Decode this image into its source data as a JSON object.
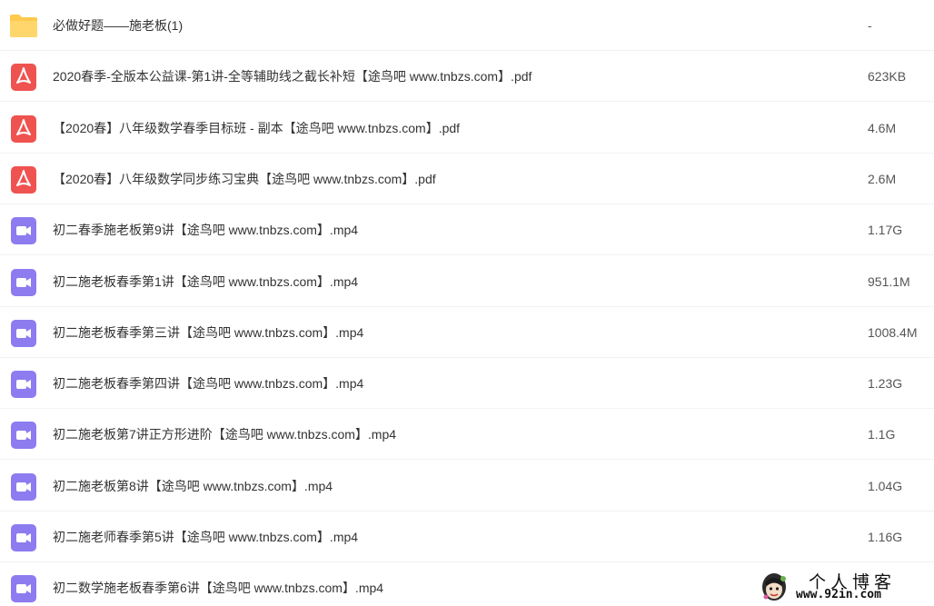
{
  "colors": {
    "folder": "#FFC94D",
    "pdf": "#EF5350",
    "video": "#8C7CF0"
  },
  "files": [
    {
      "icon": "folder-icon",
      "name": "必做好题——施老板(1)",
      "size": "-"
    },
    {
      "icon": "pdf-icon",
      "name": "2020春季-全版本公益课-第1讲-全等辅助线之截长补短【途鸟吧 www.tnbzs.com】.pdf",
      "size": "623KB"
    },
    {
      "icon": "pdf-icon",
      "name": "【2020春】八年级数学春季目标班 - 副本【途鸟吧 www.tnbzs.com】.pdf",
      "size": "4.6M"
    },
    {
      "icon": "pdf-icon",
      "name": "【2020春】八年级数学同步练习宝典【途鸟吧 www.tnbzs.com】.pdf",
      "size": "2.6M"
    },
    {
      "icon": "video-icon",
      "name": "初二春季施老板第9讲【途鸟吧 www.tnbzs.com】.mp4",
      "size": "1.17G"
    },
    {
      "icon": "video-icon",
      "name": "初二施老板春季第1讲【途鸟吧 www.tnbzs.com】.mp4",
      "size": "951.1M"
    },
    {
      "icon": "video-icon",
      "name": "初二施老板春季第三讲【途鸟吧 www.tnbzs.com】.mp4",
      "size": "1008.4M"
    },
    {
      "icon": "video-icon",
      "name": "初二施老板春季第四讲【途鸟吧 www.tnbzs.com】.mp4",
      "size": "1.23G"
    },
    {
      "icon": "video-icon",
      "name": "初二施老板第7讲正方形进阶【途鸟吧 www.tnbzs.com】.mp4",
      "size": "1.1G"
    },
    {
      "icon": "video-icon",
      "name": "初二施老板第8讲【途鸟吧 www.tnbzs.com】.mp4",
      "size": "1.04G"
    },
    {
      "icon": "video-icon",
      "name": "初二施老师春季第5讲【途鸟吧 www.tnbzs.com】.mp4",
      "size": "1.16G"
    },
    {
      "icon": "video-icon",
      "name": "初二数学施老板春季第6讲【途鸟吧 www.tnbzs.com】.mp4",
      "size": ""
    }
  ],
  "watermark": {
    "title": "个人博客",
    "url": "www.92in.com"
  }
}
